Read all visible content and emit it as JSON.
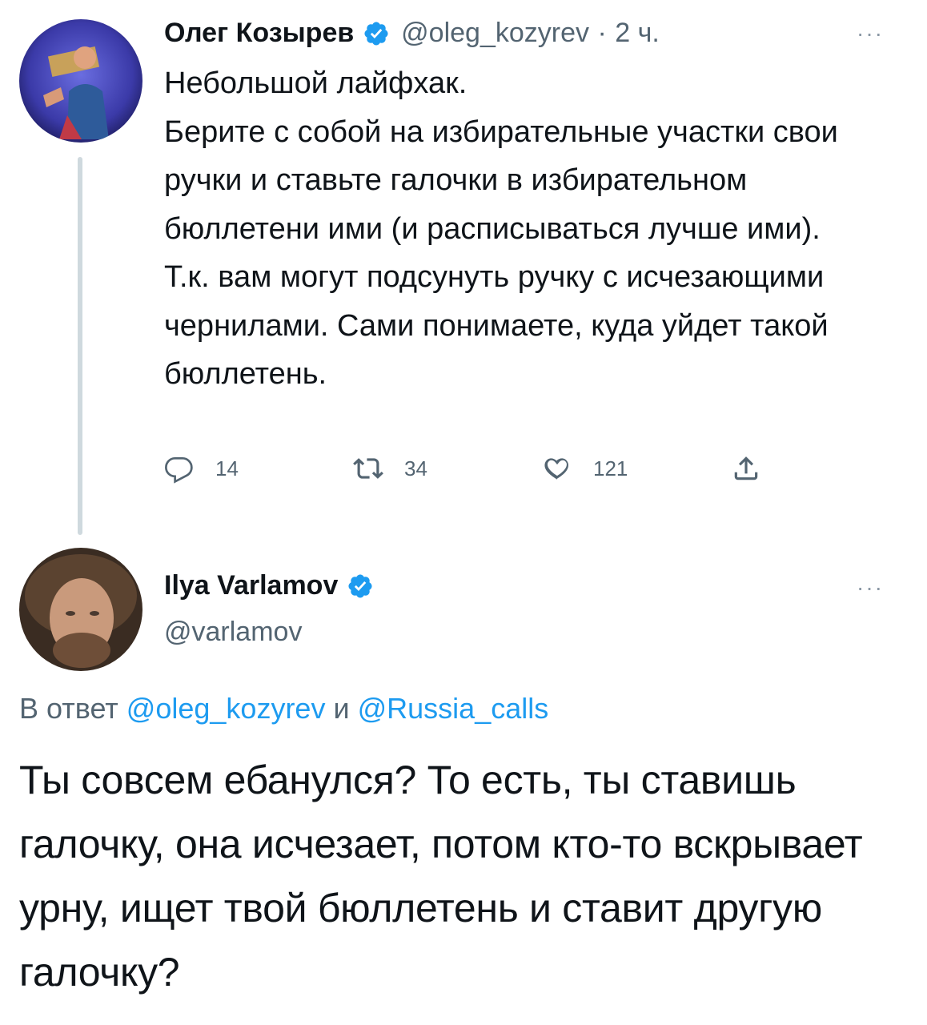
{
  "tweet1": {
    "name": "Олег Козырев",
    "handle": "@oleg_kozyrev",
    "dot": "·",
    "time": "2 ч.",
    "more": "···",
    "text": "Небольшой лайфхак.\nБерите с собой на избирательные участки свои ручки и ставьте галочки в избирательном бюллетени ими (и расписываться лучше ими).\nТ.к. вам могут подсунуть ручку с исчезающими чернилами. Сами понимаете, куда уйдет такой бюллетень.",
    "reply_count": "14",
    "retweet_count": "34",
    "like_count": "121",
    "icons": [
      "reply-icon",
      "retweet-icon",
      "like-icon",
      "share-icon"
    ]
  },
  "tweet2": {
    "name": "Ilya Varlamov",
    "handle": "@varlamov",
    "more": "···",
    "reply_prefix": "В ответ",
    "reply_user1": "@oleg_kozyrev",
    "reply_and": "и",
    "reply_user2": "@Russia_calls",
    "text": "Ты совсем ебанулся? То есть, ты ставишь галочку, она исчезает, потом кто-то вскрывает урну, ищет твой бюллетень и ставит другую галочку?"
  },
  "colors": {
    "verified": "#1d9bf0",
    "link": "#1d9bf0",
    "secondary": "#536471",
    "thread_line": "#cfd9de"
  }
}
